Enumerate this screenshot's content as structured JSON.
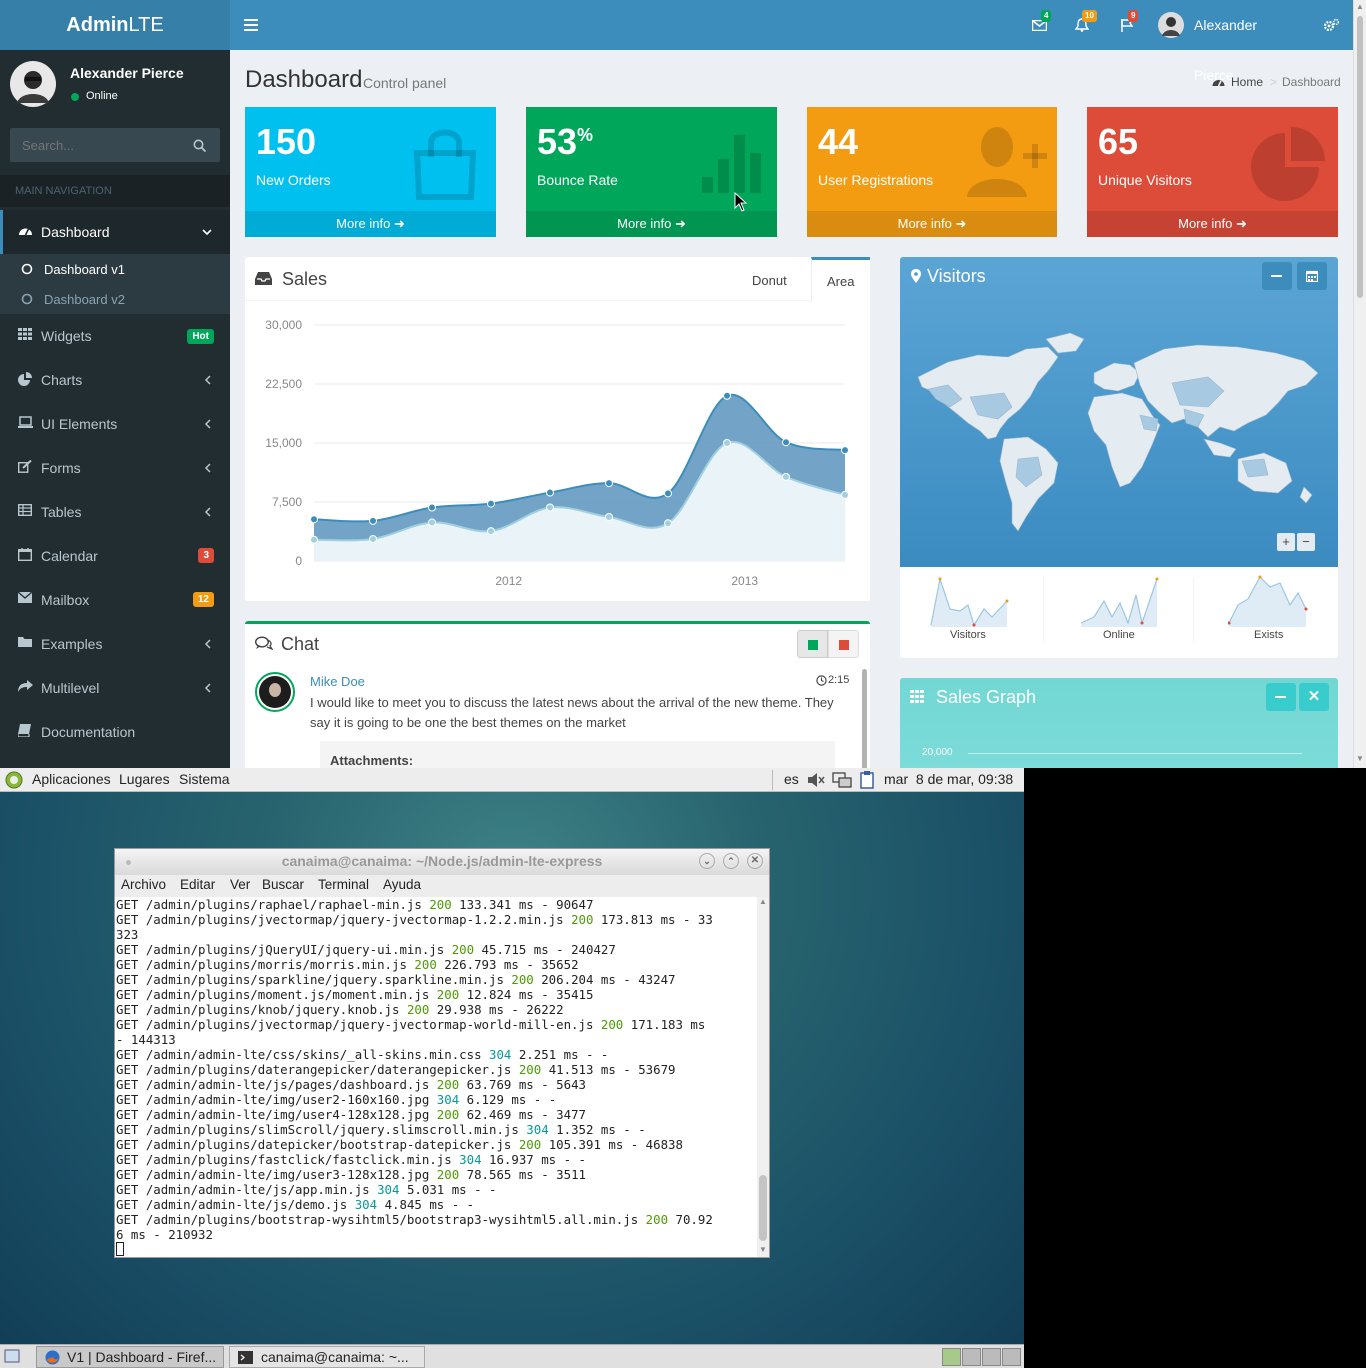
{
  "browser": {
    "logo_bold": "Admin",
    "logo_light": "LTE",
    "navbar": {
      "mail_count": "4",
      "notif_count": "10",
      "flag_count": "9",
      "user_name": "Alexander Pierce"
    },
    "sidebar": {
      "user_name": "Alexander Pierce",
      "user_status": "Online",
      "search_placeholder": "Search...",
      "nav_header": "MAIN NAVIGATION",
      "items": [
        {
          "label": "Dashboard",
          "icon": "dashboard-icon"
        },
        {
          "label": "Dashboard v1",
          "icon": "circle-icon"
        },
        {
          "label": "Dashboard v2",
          "icon": "circle-icon"
        },
        {
          "label": "Widgets",
          "icon": "th-icon",
          "badge": "Hot"
        },
        {
          "label": "Charts",
          "icon": "pie-chart-icon"
        },
        {
          "label": "UI Elements",
          "icon": "laptop-icon"
        },
        {
          "label": "Forms",
          "icon": "edit-icon"
        },
        {
          "label": "Tables",
          "icon": "table-icon"
        },
        {
          "label": "Calendar",
          "icon": "calendar-icon",
          "badge": "3"
        },
        {
          "label": "Mailbox",
          "icon": "envelope-icon",
          "badge": "12"
        },
        {
          "label": "Examples",
          "icon": "folder-icon"
        },
        {
          "label": "Multilevel",
          "icon": "share-icon"
        },
        {
          "label": "Documentation",
          "icon": "book-icon"
        }
      ]
    },
    "page": {
      "title": "Dashboard",
      "subtitle": "Control panel",
      "breadcrumb_home": "Home",
      "breadcrumb_current": "Dashboard"
    },
    "stats": [
      {
        "value": "150",
        "label": "New Orders",
        "more": "More info",
        "color": "#00c0ef"
      },
      {
        "value": "53",
        "suffix": "%",
        "label": "Bounce Rate",
        "more": "More info",
        "color": "#00a65a"
      },
      {
        "value": "44",
        "label": "User Registrations",
        "more": "More info",
        "color": "#f39c12"
      },
      {
        "value": "65",
        "label": "Unique Visitors",
        "more": "More info",
        "color": "#dd4b39"
      }
    ],
    "sales": {
      "title": "Sales",
      "tab_donut": "Donut",
      "tab_area": "Area"
    },
    "visitors": {
      "title": "Visitors",
      "spark_labels": [
        "Visitors",
        "Online",
        "Exists"
      ]
    },
    "chat": {
      "title": "Chat",
      "author": "Mike Doe",
      "time": "2:15",
      "message": "I would like to meet you to discuss the latest news about the arrival of the new theme. They say it is going to be one the best themes on the market",
      "attachments_label": "Attachments:"
    },
    "sales_graph": {
      "title": "Sales Graph",
      "first_tick": "20,000"
    }
  },
  "chart_data": {
    "type": "area",
    "y_ticks": [
      "30,000",
      "22,500",
      "15,000",
      "7,500",
      "0"
    ],
    "x_ticks": [
      "2012",
      "2013"
    ],
    "ylim": [
      0,
      30000
    ],
    "x": [
      "2011 Q1",
      "2011 Q2",
      "2011 Q3",
      "2011 Q4",
      "2012 Q1",
      "2012 Q2",
      "2012 Q3",
      "2012 Q4",
      "2013 Q1",
      "2013 Q2"
    ],
    "series": [
      {
        "values": [
          5300,
          5100,
          6800,
          7300,
          8700,
          9900,
          8600,
          21000,
          15100,
          14100
        ],
        "color": "#3c8dbc"
      },
      {
        "values": [
          2700,
          2800,
          4900,
          3800,
          6800,
          5600,
          4800,
          15000,
          10700,
          8400
        ],
        "color": "#a0d0e0"
      }
    ]
  },
  "desktop": {
    "top_panel": {
      "menus": [
        "Aplicaciones",
        "Lugares",
        "Sistema"
      ],
      "lang": "es",
      "clock": "mar  8 de mar, 09:38"
    },
    "terminal": {
      "title": "canaima@canaima: ~/Node.js/admin-lte-express",
      "menu": [
        "Archivo",
        "Editar",
        "Ver",
        "Buscar",
        "Terminal",
        "Ayuda"
      ],
      "lines": [
        [
          "GET /admin/plugins/raphael/raphael-min.js ",
          "200",
          " 133.341 ms - 90647"
        ],
        [
          "GET /admin/plugins/jvectormap/jquery-jvectormap-1.2.2.min.js ",
          "200",
          " 173.813 ms - 33\n323"
        ],
        [
          "GET /admin/plugins/jQueryUI/jquery-ui.min.js ",
          "200",
          " 45.715 ms - 240427"
        ],
        [
          "GET /admin/plugins/morris/morris.min.js ",
          "200",
          " 226.793 ms - 35652"
        ],
        [
          "GET /admin/plugins/sparkline/jquery.sparkline.min.js ",
          "200",
          " 206.204 ms - 43247"
        ],
        [
          "GET /admin/plugins/moment.js/moment.min.js ",
          "200",
          " 12.824 ms - 35415"
        ],
        [
          "GET /admin/plugins/knob/jquery.knob.js ",
          "200",
          " 29.938 ms - 26222"
        ],
        [
          "GET /admin/plugins/jvectormap/jquery-jvectormap-world-mill-en.js ",
          "200",
          " 171.183 ms\n- 144313"
        ],
        [
          "GET /admin/admin-lte/css/skins/_all-skins.min.css ",
          "304",
          " 2.251 ms - -"
        ],
        [
          "GET /admin/plugins/daterangepicker/daterangepicker.js ",
          "200",
          " 41.513 ms - 53679"
        ],
        [
          "GET /admin/admin-lte/js/pages/dashboard.js ",
          "200",
          " 63.769 ms - 5643"
        ],
        [
          "GET /admin/admin-lte/img/user2-160x160.jpg ",
          "304",
          " 6.129 ms - -"
        ],
        [
          "GET /admin/admin-lte/img/user4-128x128.jpg ",
          "200",
          " 62.469 ms - 3477"
        ],
        [
          "GET /admin/plugins/slimScroll/jquery.slimscroll.min.js ",
          "304",
          " 1.352 ms - -"
        ],
        [
          "GET /admin/plugins/datepicker/bootstrap-datepicker.js ",
          "200",
          " 105.391 ms - 46838"
        ],
        [
          "GET /admin/plugins/fastclick/fastclick.min.js ",
          "304",
          " 16.937 ms - -"
        ],
        [
          "GET /admin/admin-lte/img/user3-128x128.jpg ",
          "200",
          " 78.565 ms - 3511"
        ],
        [
          "GET /admin/admin-lte/js/app.min.js ",
          "304",
          " 5.031 ms - -"
        ],
        [
          "GET /admin/admin-lte/js/demo.js ",
          "304",
          " 4.845 ms - -"
        ],
        [
          "GET /admin/plugins/bootstrap-wysihtml5/bootstrap3-wysihtml5.all.min.js ",
          "200",
          " 70.92\n6 ms - 210932"
        ]
      ]
    },
    "taskbar": {
      "task_firefox": "V1 | Dashboard - Firef...",
      "task_terminal": "canaima@canaima: ~..."
    }
  }
}
